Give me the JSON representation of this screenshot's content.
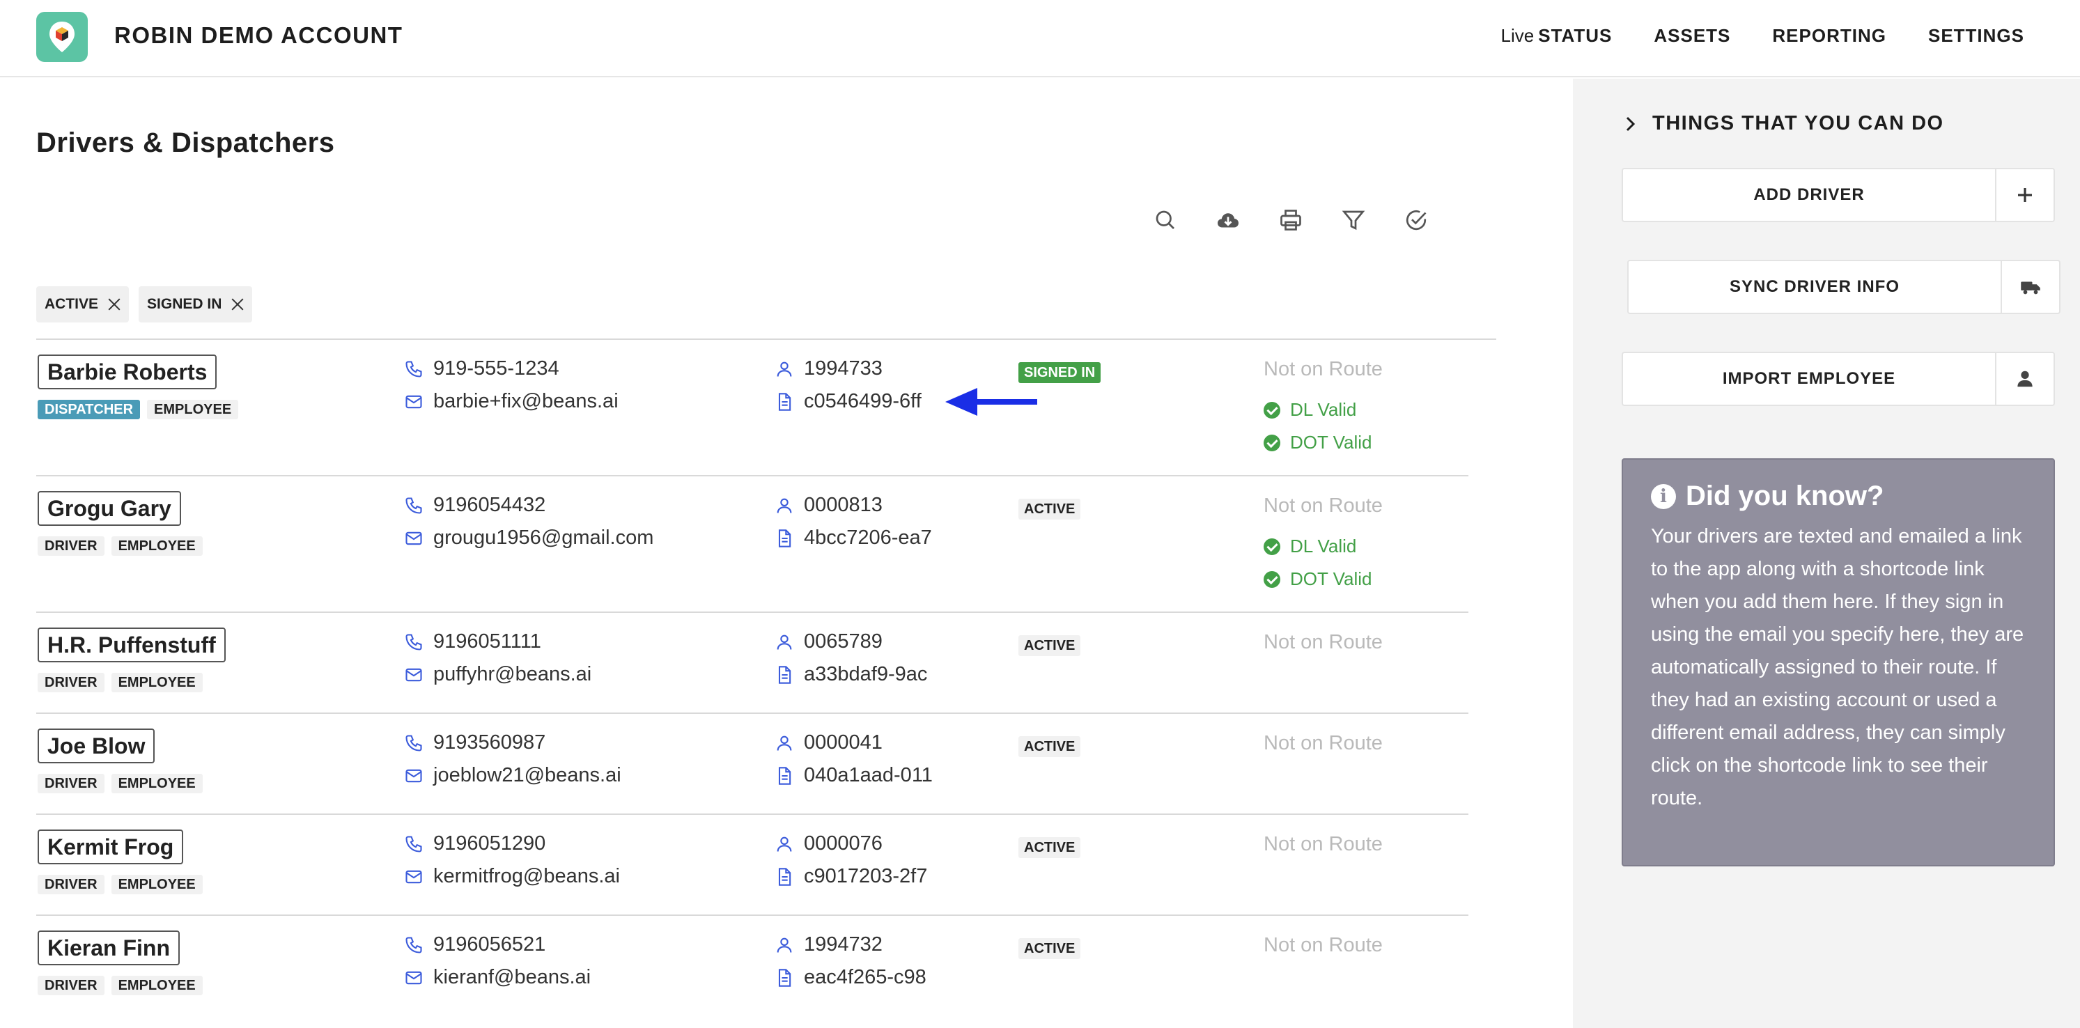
{
  "header": {
    "brand": "ROBIN DEMO ACCOUNT",
    "nav": {
      "live_prefix": "Live",
      "status": "STATUS",
      "assets": "ASSETS",
      "reporting": "REPORTING",
      "settings": "SETTINGS"
    }
  },
  "page": {
    "title": "Drivers & Dispatchers"
  },
  "toolbar": {
    "icons": [
      "search-icon",
      "cloud-download-icon",
      "print-icon",
      "filter-icon",
      "check-circle-icon"
    ]
  },
  "filters": [
    {
      "label": "ACTIVE"
    },
    {
      "label": "SIGNED IN"
    }
  ],
  "drivers": [
    {
      "name": "Barbie Roberts",
      "role": "DISPATCHER",
      "type": "EMPLOYEE",
      "phone": "919-555-1234",
      "email": "barbie+fix@beans.ai",
      "employee_id": "1994733",
      "doc_id": "c0546499-6ff",
      "status": "SIGNED IN",
      "route": "Not on Route",
      "dl": "DL Valid",
      "dot": "DOT Valid"
    },
    {
      "name": "Grogu Gary",
      "role": "DRIVER",
      "type": "EMPLOYEE",
      "phone": "9196054432",
      "email": "grougu1956@gmail.com",
      "employee_id": "0000813",
      "doc_id": "4bcc7206-ea7",
      "status": "ACTIVE",
      "route": "Not on Route",
      "dl": "DL Valid",
      "dot": "DOT Valid"
    },
    {
      "name": "H.R. Puffenstuff",
      "role": "DRIVER",
      "type": "EMPLOYEE",
      "phone": "9196051111",
      "email": "puffyhr@beans.ai",
      "employee_id": "0065789",
      "doc_id": "a33bdaf9-9ac",
      "status": "ACTIVE",
      "route": "Not on Route"
    },
    {
      "name": "Joe Blow",
      "role": "DRIVER",
      "type": "EMPLOYEE",
      "phone": "9193560987",
      "email": "joeblow21@beans.ai",
      "employee_id": "0000041",
      "doc_id": "040a1aad-011",
      "status": "ACTIVE",
      "route": "Not on Route"
    },
    {
      "name": "Kermit Frog",
      "role": "DRIVER",
      "type": "EMPLOYEE",
      "phone": "9196051290",
      "email": "kermitfrog@beans.ai",
      "employee_id": "0000076",
      "doc_id": "c9017203-2f7",
      "status": "ACTIVE",
      "route": "Not on Route"
    },
    {
      "name": "Kieran Finn",
      "role": "DRIVER",
      "type": "EMPLOYEE",
      "phone": "9196056521",
      "email": "kieranf@beans.ai",
      "employee_id": "1994732",
      "doc_id": "eac4f265-c98",
      "status": "ACTIVE",
      "route": "Not on Route"
    }
  ],
  "sidebar": {
    "heading": "THINGS THAT YOU CAN DO",
    "actions": [
      {
        "label": "ADD DRIVER",
        "icon": "plus-icon"
      },
      {
        "label": "SYNC DRIVER INFO",
        "icon": "truck-icon"
      },
      {
        "label": "IMPORT EMPLOYEE",
        "icon": "user-icon"
      }
    ],
    "did_you_know": {
      "title": "Did you know?",
      "body": "Your drivers are texted and emailed a link to the app along with a shortcode link when you add them here. If they sign in using the email you specify here, they are automatically assigned to their route. If they had an existing account or used a different email address, they can simply click on the shortcode link to see their route."
    }
  },
  "colors": {
    "brand": "#5cc4a4",
    "signed_in": "#43a047",
    "valid": "#43a047",
    "dispatcher": "#4a9bb7",
    "icon_blue": "#3b5bdb",
    "arrow": "#1a2ee6",
    "info_panel": "#918f9e"
  }
}
